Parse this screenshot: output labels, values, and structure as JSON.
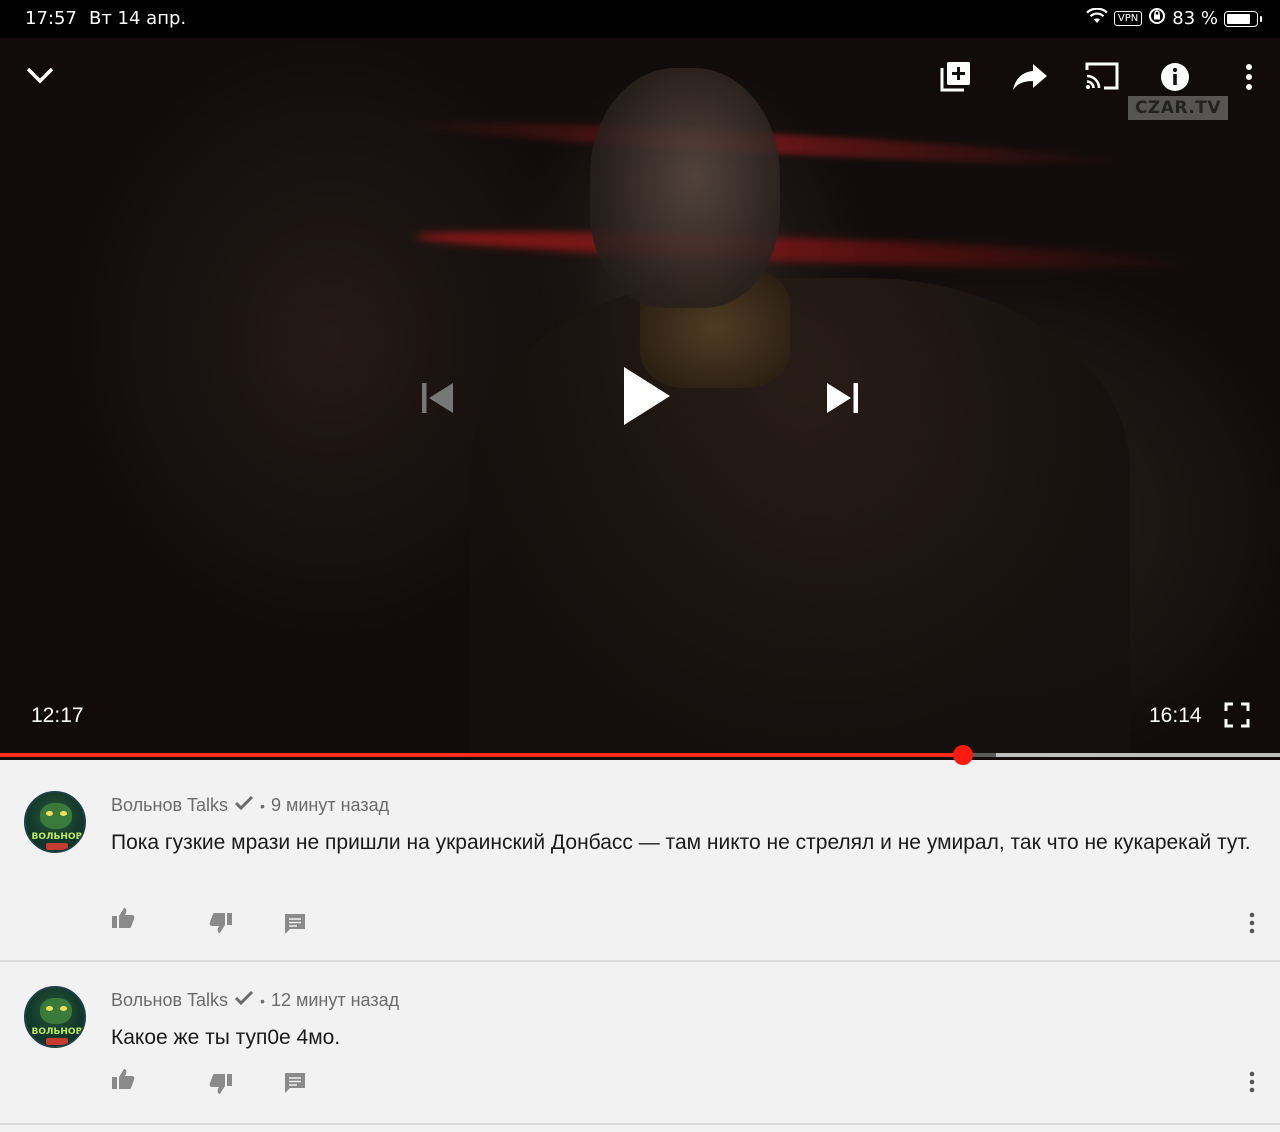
{
  "status_bar": {
    "time": "17:57",
    "date": "Вт 14 апр.",
    "vpn": "VPN",
    "battery_percent": "83 %",
    "battery_level": 0.83
  },
  "player": {
    "watermark": "CZAR.TV",
    "current_time": "12:17",
    "total_time": "16:14",
    "progress": 0.7523,
    "buffered": 0.778,
    "accent_color": "#ff2a1a"
  },
  "comments": [
    {
      "author": "Вольнов Talks",
      "time_ago": "9 минут назад",
      "text": "Пока гузкие мрази не пришли на украинский Донбасс — там никто не стрелял и не умирал, так что не кукарекай тут.",
      "avatar_text": "ВОЛЬНОВ"
    },
    {
      "author": "Вольнов Talks",
      "time_ago": "12 минут назад",
      "text": "Какое же ты туп0е 4мо.",
      "avatar_text": "ВОЛЬНОВ"
    }
  ]
}
